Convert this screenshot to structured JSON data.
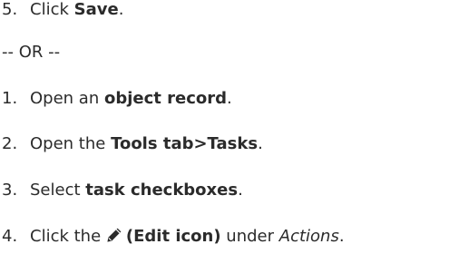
{
  "steps_top": [
    {
      "num": "5.",
      "pre": "Click ",
      "bold": "Save",
      "post": "."
    }
  ],
  "separator": "-- OR --",
  "steps": [
    {
      "num": "1.",
      "pre": "Open an ",
      "bold": "object record",
      "post": "."
    },
    {
      "num": "2.",
      "pre": "Open the ",
      "bold": "Tools tab>Tasks",
      "post": "."
    },
    {
      "num": "3.",
      "pre": "Select ",
      "bold": "task checkboxes",
      "post": "."
    },
    {
      "num": "4.",
      "pre": "Click the ",
      "icon": "pencil-icon",
      "bold": "(Edit icon)",
      "mid": " under ",
      "italic": "Actions",
      "post": "."
    }
  ]
}
